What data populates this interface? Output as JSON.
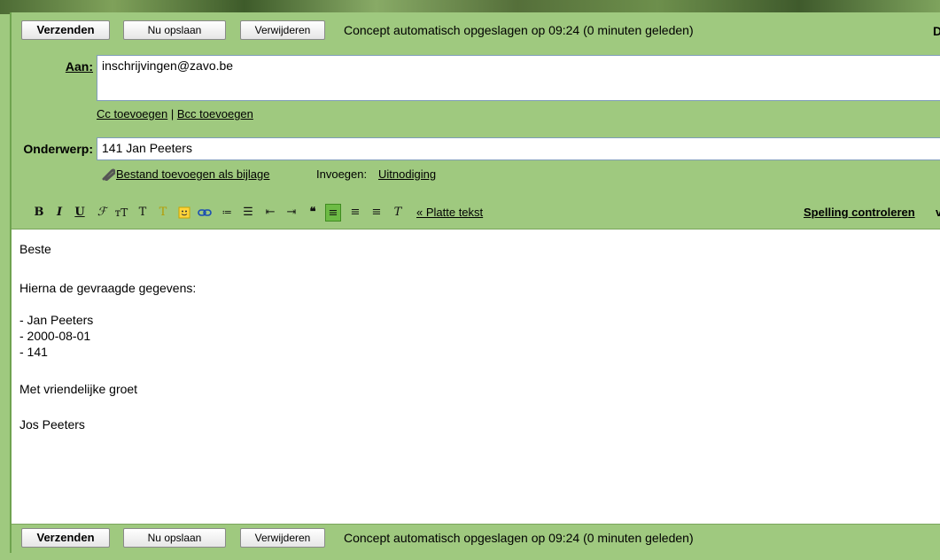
{
  "top_bar": {
    "send_label": "Verzenden",
    "save_label": "Nu opslaan",
    "delete_label": "Verwijderen",
    "status": "Concept automatisch opgeslagen op 09:24 (0 minuten geleden)",
    "clipped_text": "D"
  },
  "to": {
    "label": "Aan:",
    "value": "inschrijvingen@zavo.be"
  },
  "add_links": {
    "cc": "Cc toevoegen",
    "separator": "|",
    "bcc": "Bcc toevoegen"
  },
  "subject": {
    "label": "Onderwerp:",
    "value": "141 Jan Peeters"
  },
  "attach": {
    "link": "Bestand toevoegen als bijlage",
    "insert_label": "Invoegen:",
    "invite_link": "Uitnodiging"
  },
  "format_toolbar": {
    "plain_text_link": "« Platte tekst",
    "spellcheck_link": "Spelling controleren",
    "clipped_text": "v",
    "icons": [
      "bold-icon",
      "italic-icon",
      "underline-icon",
      "font-icon",
      "font-size-icon",
      "text-color-icon",
      "highlight-icon",
      "emoticon-icon",
      "link-icon",
      "numbered-list-icon",
      "bulleted-list-icon",
      "indent-less-icon",
      "indent-more-icon",
      "quote-icon",
      "align-left-icon",
      "align-center-icon",
      "align-right-icon",
      "remove-formatting-icon"
    ]
  },
  "body_lines": [
    "Beste",
    "Hierna de gevraagde gegevens:",
    "- Jan Peeters",
    "- 2000-08-01",
    "- 141",
    "Met vriendelijke groet",
    "Jos Peeters"
  ],
  "bottom_bar": {
    "send_label": "Verzenden",
    "save_label": "Nu opslaan",
    "delete_label": "Verwijderen",
    "status": "Concept automatisch opgeslagen op 09:24 (0 minuten geleden)"
  },
  "colors": {
    "panel": "#9fc97f",
    "active_button": "#6dbb45"
  }
}
